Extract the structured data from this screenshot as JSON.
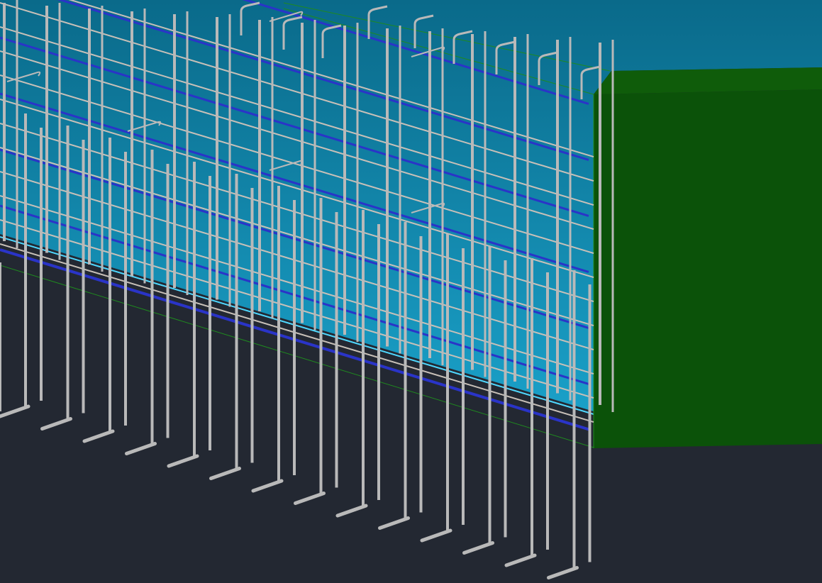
{
  "view": {
    "background": "#232832",
    "wall_face_top": "#0a6a8a",
    "wall_face_bottom": "#1aa0c8",
    "wall_edge_color": "#4fd8ff",
    "end_cap_color": "#0b5209",
    "end_cap_top_color": "#0f5c0a",
    "guide_line_color": "#1f8a1f",
    "rebar_color": "#b9b9b9",
    "horizontal_bar_color": "#c8c0b8",
    "blue_bar_color": "#2a34c8",
    "icons": [
      "rebar-cage-3d",
      "concrete-wall-body",
      "wall-end-cap",
      "dowel-bar",
      "hook-bar",
      "stirrup-tie"
    ]
  }
}
